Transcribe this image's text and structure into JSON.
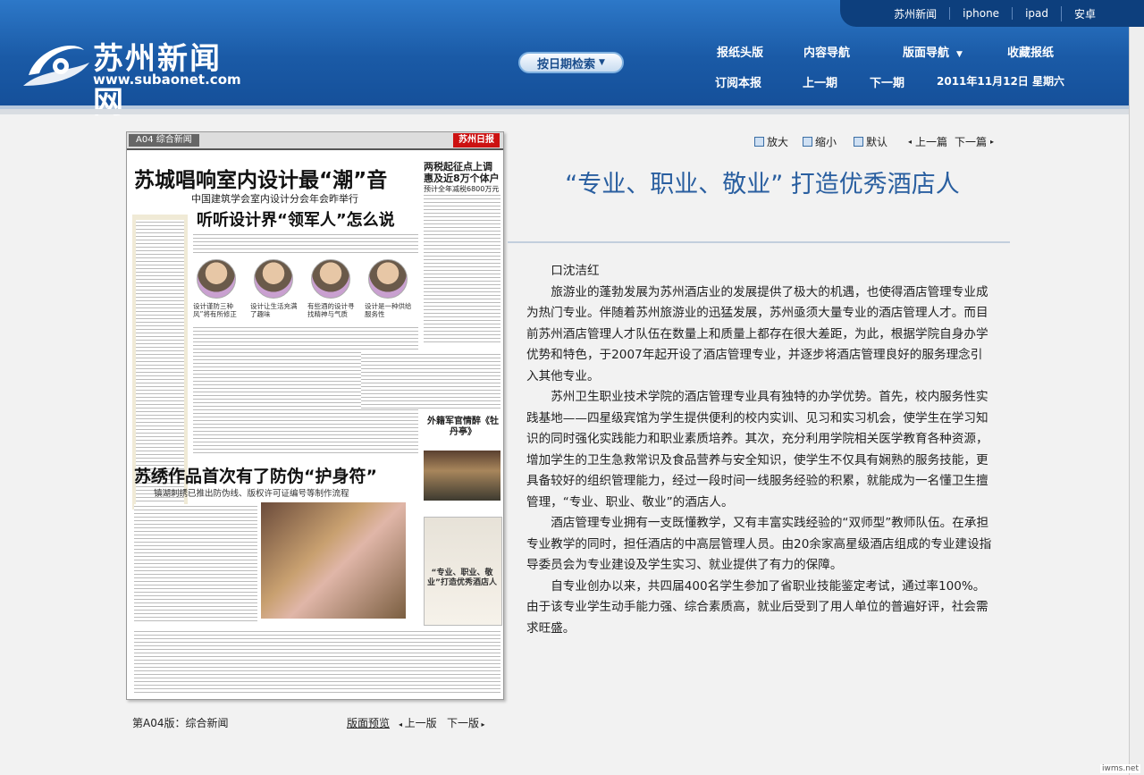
{
  "top_links": [
    "苏州新闻",
    "iphone",
    "ipad",
    "安卓"
  ],
  "logo": {
    "title": "苏州新闻网",
    "url": "www.subaonet.com"
  },
  "date_search": {
    "label": "按日期检索"
  },
  "nav_row1": [
    "报纸头版",
    "内容导航",
    "版面导航",
    "收藏报纸"
  ],
  "nav_row2": [
    "订阅本报",
    "上一期",
    "下一期"
  ],
  "date_text": "2011年11月12日  星期六",
  "paper": {
    "section": "A04 综合新闻",
    "brand": "苏州日报",
    "headline1": "苏城唱响室内设计最“潮”音",
    "sub1": "中国建筑学会室内设计分会年会昨举行",
    "headline1b": "听听设计界“领军人”怎么说",
    "face_captions": [
      "设计谨防三种风”将有所修正",
      "设计让生活充满了趣味",
      "有些酒的设计寻找精神与气质",
      "设计是一种供给服务性"
    ],
    "side_head": "两税起征点上调惠及近8万个体户",
    "side_head_sub": "预计全年减税6800万元",
    "mid_head": "外籍军官情醉《牡丹亭》",
    "ad_caption": "“专业、职业、敬业”打造优秀酒店人",
    "headline2": "苏绣作品首次有了防伪“护身符”",
    "sub2": "镇湖刺绣已推出防伪线、版权许可证编号等制作流程"
  },
  "page_footer": {
    "label": "第A04版：综合新闻",
    "preview": "版面预览",
    "prev": "上一版",
    "next": "下一版"
  },
  "tools": {
    "zoom_in": "放大",
    "zoom_out": "缩小",
    "default": "默认",
    "prev": "上一篇",
    "next": "下一篇"
  },
  "article": {
    "title": "“专业、职业、敬业”    打造优秀酒店人",
    "author": "口沈洁红",
    "paragraphs": [
      "旅游业的蓬勃发展为苏州酒店业的发展提供了极大的机遇，也使得酒店管理专业成为热门专业。伴随着苏州旅游业的迅猛发展，苏州亟须大量专业的酒店管理人才。而目前苏州酒店管理人才队伍在数量上和质量上都存在很大差距，为此，根据学院自身办学优势和特色，于2007年起开设了酒店管理专业，并逐步将酒店管理良好的服务理念引入其他专业。",
      "苏州卫生职业技术学院的酒店管理专业具有独特的办学优势。首先，校内服务性实践基地——四星级宾馆为学生提供便利的校内实训、见习和实习机会，使学生在学习知识的同时强化实践能力和职业素质培养。其次，充分利用学院相关医学教育各种资源，增加学生的卫生急救常识及食品营养与安全知识，使学生不仅具有娴熟的服务技能，更具备较好的组织管理能力，经过一段时间一线服务经验的积累，就能成为一名懂卫生擅管理，“专业、职业、敬业”的酒店人。",
      "酒店管理专业拥有一支既懂教学，又有丰富实践经验的“双师型”教师队伍。在承担专业教学的同时，担任酒店的中高层管理人员。由20余家高星级酒店组成的专业建设指导委员会为专业建设及学生实习、就业提供了有力的保障。",
      "自专业创办以来，共四届400名学生参加了省职业技能鉴定考试，通过率100%。由于该专业学生动手能力强、综合素质高，就业后受到了用人单位的普遍好评，社会需求旺盛。"
    ]
  },
  "watermark": "iwms.net"
}
